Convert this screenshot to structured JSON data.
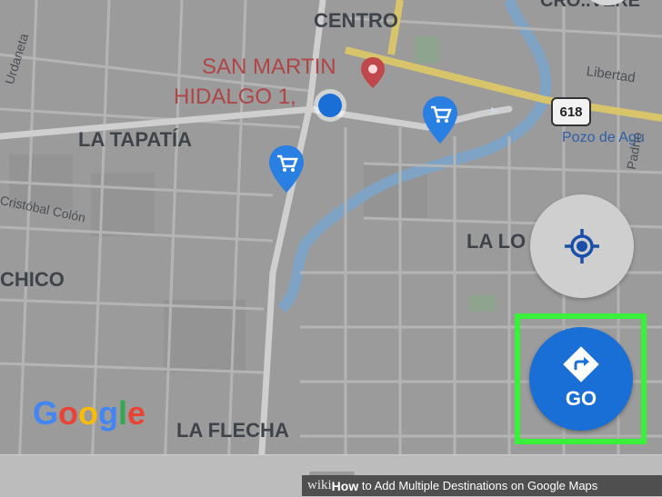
{
  "map": {
    "neighborhoods": [
      "CENTRO",
      "LA TAPATÍA",
      "CHICO",
      "LA LO",
      "LA FLECHA",
      "CRO..VERE"
    ],
    "poi_label_line1": "SAN MARTIN",
    "poi_label_line2": "HIDALGO 1,",
    "streets": [
      "Urdaneta",
      "Cristóbal Colón",
      "Libertad",
      "Pozo de Agu",
      "Padrío"
    ],
    "highway_shield": "618",
    "logo_text": "Google"
  },
  "controls": {
    "go_label": "GO"
  },
  "footer": {
    "brand_prefix": "wiki",
    "brand_bold": "How",
    "caption": " to Add Multiple Destinations on Google Maps"
  },
  "colors": {
    "map_bg": "#9a9a9a",
    "accent_blue": "#1a6fd6",
    "highlight_green": "#39f03a",
    "poi_red": "#c0474a"
  }
}
